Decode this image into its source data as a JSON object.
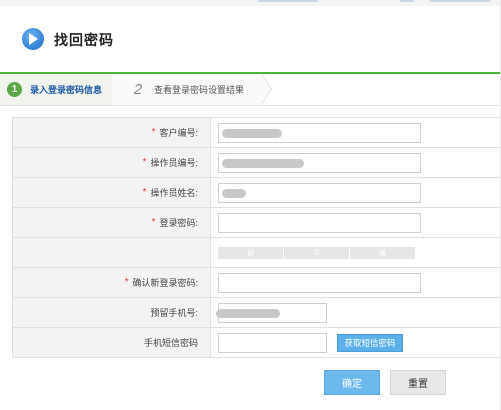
{
  "header": {
    "title": "找回密码",
    "icon": "play-circle-icon",
    "accent": "#2f7fd3"
  },
  "steps": [
    {
      "number": "1",
      "label": "录入登录密码信息",
      "active": true
    },
    {
      "number": "2",
      "label": "查看登录密码设置结果",
      "active": false
    }
  ],
  "colors": {
    "step_active": "#5aa845",
    "divider": "#4db33d",
    "required": "#e23c3c",
    "primary_button": "#6cb9ee"
  },
  "form": {
    "customer_id": {
      "label": "客户编号:",
      "required": true,
      "value": ""
    },
    "operator_id": {
      "label": "操作员编号:",
      "required": true,
      "value": ""
    },
    "operator_name": {
      "label": "操作员姓名:",
      "required": true,
      "value": ""
    },
    "login_password": {
      "label": "登录密码:",
      "required": true,
      "value": ""
    },
    "password_strength": {
      "levels": [
        "弱",
        "中",
        "强"
      ]
    },
    "confirm_password": {
      "label": "确认新登录密码:",
      "required": true,
      "value": ""
    },
    "reserved_phone": {
      "label": "预留手机号:",
      "required": false,
      "value": ""
    },
    "sms_code": {
      "label": "手机短信密码",
      "required": false,
      "value": "",
      "button_label": "获取短信密码"
    }
  },
  "actions": {
    "confirm_label": "确定",
    "reset_label": "重置"
  }
}
